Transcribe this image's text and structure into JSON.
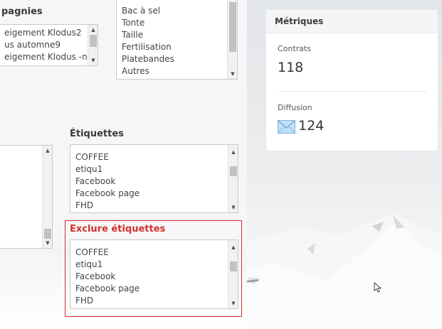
{
  "companies": {
    "heading": "pagnies",
    "items": [
      "eigement Klodus2",
      "us automne9",
      "eigement Klodus -neige"
    ]
  },
  "services": {
    "items": [
      "Bac à sel",
      "Tonte",
      "Taille",
      "Fertilisation",
      "Platebandes",
      "Autres"
    ]
  },
  "tags": {
    "heading": "Étiquettes",
    "items": [
      "COFFEE",
      "etiqu1",
      "Facebook",
      "Facebook page",
      "FHD"
    ]
  },
  "exclude_tags": {
    "heading": "Exclure étiquettes",
    "items": [
      "COFFEE",
      "etiqu1",
      "Facebook",
      "Facebook page",
      "FHD"
    ]
  },
  "metrics": {
    "title": "Métriques",
    "contracts_label": "Contrats",
    "contracts_value": "118",
    "diffusion_label": "Diffusion",
    "diffusion_value": "124"
  },
  "icons": {
    "email": "envelope-icon",
    "cursor": "mouse-pointer-icon"
  },
  "colors": {
    "exclude_accent": "#d32f2f",
    "envelope": "#9cc9ea"
  }
}
